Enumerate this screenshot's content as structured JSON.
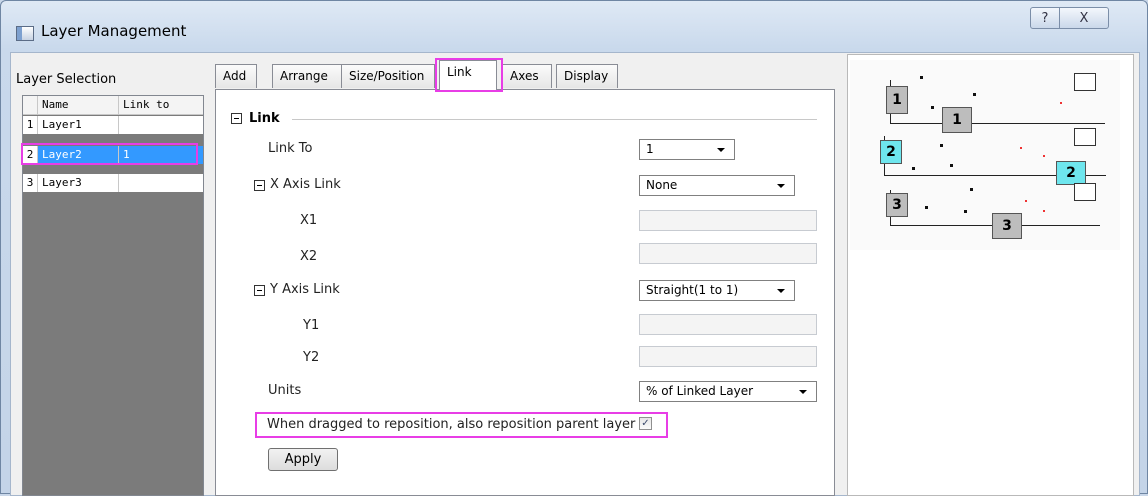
{
  "window": {
    "title": "Layer Management",
    "help_glyph": "?",
    "close_glyph": "X"
  },
  "layer_selection": {
    "label": "Layer Selection",
    "columns": [
      "Name",
      "Link to"
    ],
    "rows": [
      {
        "index": "1",
        "name": "Layer1",
        "link_to": ""
      },
      {
        "index": "2",
        "name": "Layer2",
        "link_to": "1",
        "selected": true
      },
      {
        "index": "3",
        "name": "Layer3",
        "link_to": ""
      }
    ]
  },
  "tabs": [
    {
      "label": "Add"
    },
    {
      "label": "Arrange"
    },
    {
      "label": "Size/Position"
    },
    {
      "label": "Link",
      "active": true
    },
    {
      "label": "Axes"
    },
    {
      "label": "Display"
    }
  ],
  "link": {
    "section_title": "Link",
    "link_to_label": "Link To",
    "link_to_value": "1",
    "x_axis_label": "X Axis Link",
    "x_axis_value": "None",
    "x1_label": "X1",
    "x2_label": "X2",
    "y_axis_label": "Y Axis Link",
    "y_axis_value": "Straight(1 to 1)",
    "y1_label": "Y1",
    "y2_label": "Y2",
    "units_label": "Units",
    "units_value": "% of Linked Layer",
    "reposition_label": "When dragged to reposition, also reposition parent layer",
    "reposition_checked": true,
    "apply_label": "Apply"
  },
  "preview": {
    "layers": [
      {
        "label": "1"
      },
      {
        "label": "1"
      },
      {
        "label": "2"
      },
      {
        "label": "2"
      },
      {
        "label": "3"
      },
      {
        "label": "3"
      }
    ]
  },
  "colors": {
    "highlight": "#e83de6",
    "selection": "#3399ff",
    "active_layer": "#6ee6ee"
  }
}
